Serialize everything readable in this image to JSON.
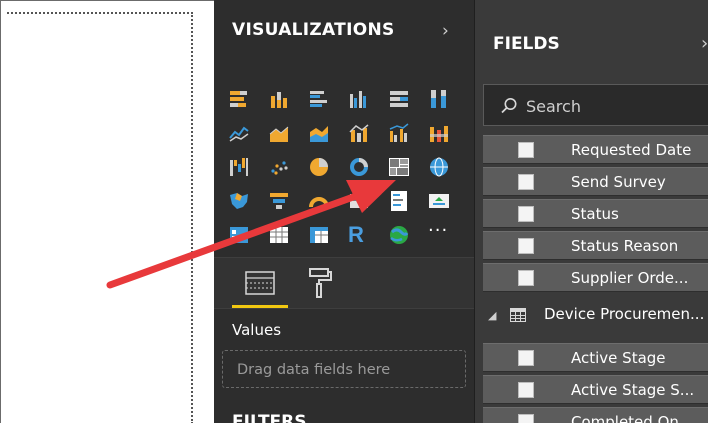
{
  "visualizations": {
    "title": "VISUALIZATIONS",
    "expand_icon": "chevron-right-icon",
    "icons": [
      "stacked-bar-chart",
      "stacked-column-chart",
      "clustered-bar-chart",
      "clustered-column-chart",
      "100-stacked-bar-chart",
      "100-stacked-column-chart",
      "line-chart",
      "area-chart",
      "stacked-area-chart",
      "line-and-stacked-column-chart",
      "line-and-clustered-column-chart",
      "ribbon-chart",
      "waterfall-chart",
      "scatter-chart",
      "pie-chart",
      "donut-chart",
      "treemap",
      "map",
      "filled-map",
      "funnel",
      "gauge",
      "card",
      "multi-row-card",
      "kpi",
      "slicer",
      "table",
      "matrix",
      "r-script-visual",
      "arcgis-map",
      "more-options"
    ],
    "r_label": "R",
    "more_label": "···",
    "tabs": [
      "fields-tab",
      "format-tab"
    ],
    "values_label": "Values",
    "drag_placeholder": "Drag data fields here",
    "filters_label": "FILTERS"
  },
  "fields": {
    "title": "FIELDS",
    "search_placeholder": "Search",
    "items": [
      {
        "label": "Requested Date",
        "checked": false
      },
      {
        "label": "Send Survey",
        "checked": false
      },
      {
        "label": "Status",
        "checked": false
      },
      {
        "label": "Status Reason",
        "checked": false
      },
      {
        "label": "Supplier Orde...",
        "checked": false
      }
    ],
    "table": {
      "label": "Device Procuremen...",
      "expanded": true,
      "items": [
        {
          "label": "Active Stage",
          "checked": false
        },
        {
          "label": "Active Stage S...",
          "checked": false
        },
        {
          "label": "Completed On",
          "checked": false
        }
      ]
    }
  },
  "colors": {
    "pane_bg": "#2d2d2d",
    "fields_bg": "#3a3a3a",
    "accent_yellow": "#f2c811",
    "annotation_arrow": "#e8393b"
  }
}
